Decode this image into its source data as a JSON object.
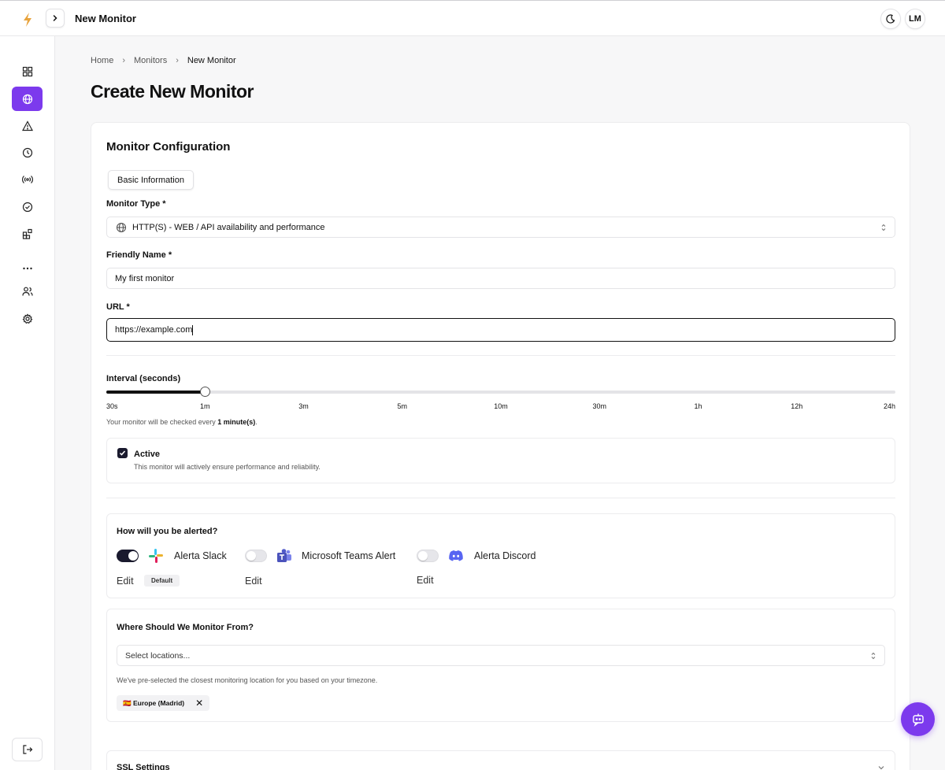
{
  "topbar": {
    "title": "New Monitor",
    "avatar_initials": "LM"
  },
  "sidebar": {
    "items": [
      {
        "name": "dashboard",
        "icon": "grid-icon",
        "active": false
      },
      {
        "name": "monitors",
        "icon": "globe-icon",
        "active": true
      },
      {
        "name": "incidents",
        "icon": "warning-icon",
        "active": false
      },
      {
        "name": "history",
        "icon": "clock-icon",
        "active": false
      },
      {
        "name": "broadcast",
        "icon": "broadcast-icon",
        "active": false
      },
      {
        "name": "checks",
        "icon": "check-circle-icon",
        "active": false
      },
      {
        "name": "integrations",
        "icon": "blocks-icon",
        "active": false
      },
      {
        "name": "more",
        "icon": "more-icon",
        "active": false
      },
      {
        "name": "team",
        "icon": "users-icon",
        "active": false
      },
      {
        "name": "settings",
        "icon": "gear-icon",
        "active": false
      }
    ]
  },
  "breadcrumb": {
    "home": "Home",
    "monitors": "Monitors",
    "current": "New Monitor"
  },
  "page": {
    "title": "Create New Monitor"
  },
  "form": {
    "card_title": "Monitor Configuration",
    "tab": "Basic Information",
    "monitor_type_label": "Monitor Type *",
    "monitor_type_value": "HTTP(S) - WEB / API availability and performance",
    "friendly_name_label": "Friendly Name *",
    "friendly_name_value": "My first monitor",
    "url_label": "URL *",
    "url_value": "https://example.com",
    "interval_label": "Interval (seconds)",
    "interval_ticks": [
      "30s",
      "1m",
      "3m",
      "5m",
      "10m",
      "30m",
      "1h",
      "12h",
      "24h"
    ],
    "interval_selected_index": 1,
    "interval_hint_prefix": "Your monitor will be checked every ",
    "interval_hint_value": "1 minute(s)",
    "interval_hint_suffix": ".",
    "active_label": "Active",
    "active_desc": "This monitor will actively ensure performance and reliability.",
    "active_checked": true
  },
  "alerts": {
    "title": "How will you be alerted?",
    "channels": [
      {
        "name": "Alerta Slack",
        "enabled": true,
        "edit": "Edit",
        "badge": "Default",
        "icon": "slack-icon"
      },
      {
        "name": "Microsoft Teams Alert",
        "enabled": false,
        "edit": "Edit",
        "icon": "teams-icon"
      },
      {
        "name": "Alerta Discord",
        "enabled": false,
        "edit": "Edit",
        "icon": "discord-icon"
      }
    ]
  },
  "locations": {
    "title": "Where Should We Monitor From?",
    "placeholder": "Select locations...",
    "hint": "We've pre-selected the closest monitoring location for you based on your timezone.",
    "selected": [
      {
        "flag": "🇪🇸",
        "label": "Europe (Madrid)"
      }
    ]
  },
  "ssl": {
    "title": "SSL Settings"
  },
  "colors": {
    "accent": "#7c3aed",
    "dark": "#1a1a2e",
    "logo": "#e8a33d"
  }
}
